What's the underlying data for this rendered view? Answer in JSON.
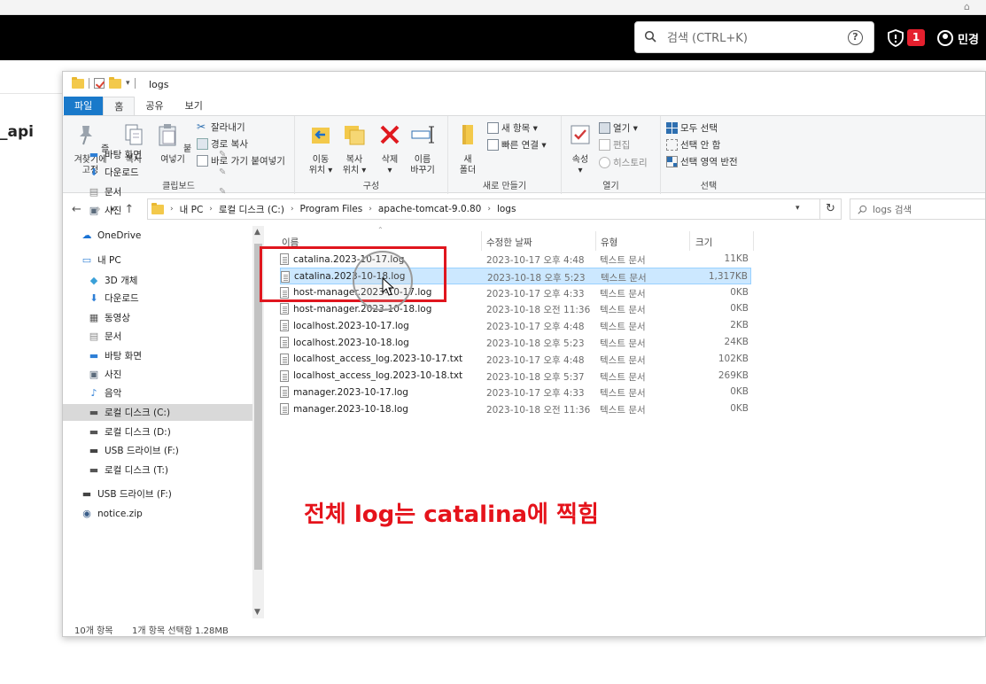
{
  "app_header": {
    "search_placeholder": "검색 (CTRL+K)",
    "help_glyph": "?",
    "notification_count": "1",
    "user_name": "민경"
  },
  "background": {
    "side_text": "_api"
  },
  "explorer": {
    "title": "logs",
    "tabs": [
      "파일",
      "홈",
      "공유",
      "보기"
    ],
    "ribbon": {
      "clipboard": {
        "label": "클립보드",
        "pin_quick": "즐겨찾기에\n고정",
        "copy": "복사",
        "paste": "붙여넣기",
        "cut": "잘라내기",
        "copy_path": "경로 복사",
        "paste_shortcut": "바로 가기 붙여넣기"
      },
      "organize": {
        "label": "구성",
        "move_to": "이동\n위치 ▾",
        "copy_to": "복사\n위치 ▾",
        "delete": "삭제\n▾",
        "rename": "이름\n바꾸기"
      },
      "new": {
        "label": "새로 만들기",
        "new_folder": "새\n폴더",
        "new_item": "새 항목 ▾",
        "easy_access": "빠른 연결 ▾"
      },
      "open": {
        "label": "열기",
        "properties": "속성\n▾",
        "open": "열기 ▾",
        "edit": "편집",
        "history": "히스토리"
      },
      "select": {
        "label": "선택",
        "select_all": "모두 선택",
        "select_none": "선택 안 함",
        "invert": "선택 영역 반전"
      }
    },
    "address": {
      "path": [
        "내 PC",
        "로컬 디스크 (C:)",
        "Program Files",
        "apache-tomcat-9.0.80",
        "logs"
      ],
      "search_placeholder": "logs 검색"
    },
    "nav": [
      {
        "label": "바탕 화면",
        "icon": "desktop-icon",
        "pinned": true
      },
      {
        "label": "다운로드",
        "icon": "download-icon",
        "pinned": true
      },
      {
        "label": "문서",
        "icon": "document-icon",
        "pinned": true
      },
      {
        "label": "사진",
        "icon": "picture-icon",
        "pinned": true
      },
      {
        "label": "OneDrive",
        "icon": "cloud-icon"
      },
      {
        "label": "내 PC",
        "icon": "pc-icon"
      },
      {
        "label": "3D 개체",
        "icon": "cube-icon"
      },
      {
        "label": "다운로드",
        "icon": "download-icon"
      },
      {
        "label": "동영상",
        "icon": "video-icon"
      },
      {
        "label": "문서",
        "icon": "document-icon"
      },
      {
        "label": "바탕 화면",
        "icon": "desktop-icon"
      },
      {
        "label": "사진",
        "icon": "picture-icon"
      },
      {
        "label": "음악",
        "icon": "music-icon"
      },
      {
        "label": "로컬 디스크 (C:)",
        "icon": "drive-icon",
        "selected": true
      },
      {
        "label": "로컬 디스크 (D:)",
        "icon": "drive-icon"
      },
      {
        "label": "USB 드라이브 (F:)",
        "icon": "usb-icon"
      },
      {
        "label": "로컬 디스크 (T:)",
        "icon": "drive-icon"
      },
      {
        "label": "USB 드라이브 (F:)",
        "icon": "usb-icon"
      },
      {
        "label": "notice.zip",
        "icon": "zip-icon"
      }
    ],
    "columns": {
      "name": "이름",
      "modified": "수정한 날짜",
      "type": "유형",
      "size": "크기"
    },
    "files": [
      {
        "name": "catalina.2023-10-17.log",
        "modified": "2023-10-17 오후 4:48",
        "type": "텍스트 문서",
        "size": "11KB"
      },
      {
        "name": "catalina.2023-10-18.log",
        "modified": "2023-10-18 오후 5:23",
        "type": "텍스트 문서",
        "size": "1,317KB",
        "selected": true
      },
      {
        "name": "host-manager.2023-10-17.log",
        "modified": "2023-10-17 오후 4:33",
        "type": "텍스트 문서",
        "size": "0KB"
      },
      {
        "name": "host-manager.2023-10-18.log",
        "modified": "2023-10-18 오전 11:36",
        "type": "텍스트 문서",
        "size": "0KB"
      },
      {
        "name": "localhost.2023-10-17.log",
        "modified": "2023-10-17 오후 4:48",
        "type": "텍스트 문서",
        "size": "2KB"
      },
      {
        "name": "localhost.2023-10-18.log",
        "modified": "2023-10-18 오후 5:23",
        "type": "텍스트 문서",
        "size": "24KB"
      },
      {
        "name": "localhost_access_log.2023-10-17.txt",
        "modified": "2023-10-17 오후 4:48",
        "type": "텍스트 문서",
        "size": "102KB"
      },
      {
        "name": "localhost_access_log.2023-10-18.txt",
        "modified": "2023-10-18 오후 5:37",
        "type": "텍스트 문서",
        "size": "269KB"
      },
      {
        "name": "manager.2023-10-17.log",
        "modified": "2023-10-17 오후 4:33",
        "type": "텍스트 문서",
        "size": "0KB"
      },
      {
        "name": "manager.2023-10-18.log",
        "modified": "2023-10-18 오전 11:36",
        "type": "텍스트 문서",
        "size": "0KB"
      }
    ],
    "status": {
      "count": "10개 항목",
      "selection": "1개 항목 선택함 1.28MB"
    }
  },
  "annotation": {
    "text": "전체 log는 catalina에 찍힘",
    "color": "#e5131b"
  },
  "colors": {
    "header_bg": "#000000",
    "selection": "#cce8ff",
    "file_tab": "#1979ca",
    "badge": "#e5202e"
  }
}
